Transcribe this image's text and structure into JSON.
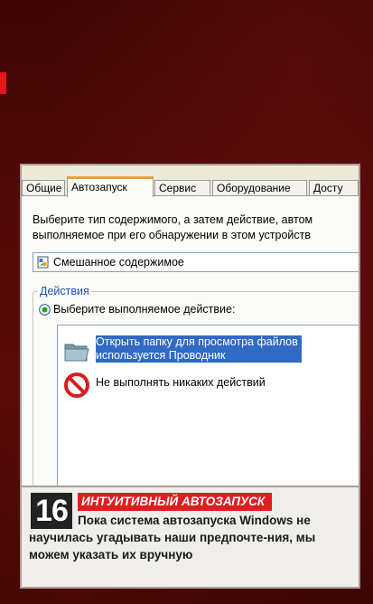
{
  "tabs": [
    "Общие",
    "Автозапуск",
    "Сервис",
    "Оборудование",
    "Досту"
  ],
  "description": [
    "Выберите тип содержимого, а затем действие, автом",
    "выполняемое при его обнаружении в этом устройств"
  ],
  "content_select": {
    "value": "Смешанное содержимое",
    "icon": "mixed-content-icon"
  },
  "actions_group": {
    "legend": "Действия",
    "radio_label": "Выберите выполняемое действие:",
    "items": [
      {
        "text": "Открыть папку для просмотра файлов",
        "text2": "используется Проводник",
        "icon": "folder-icon",
        "selected": true
      },
      {
        "text": "Не выполнять никаких действий",
        "icon": "no-action-icon",
        "selected": false
      }
    ]
  },
  "caption": {
    "number": "16",
    "headline": "ИНТУИТИВНЫЙ АВТОЗАПУСК",
    "text": "Пока система автозапуска Windows не научилась угадывать наши предпочте-ния, мы можем указать их вручную"
  },
  "colors": {
    "accent": "#e21c1f",
    "selection": "#316ac5",
    "background": "#4a0707"
  }
}
